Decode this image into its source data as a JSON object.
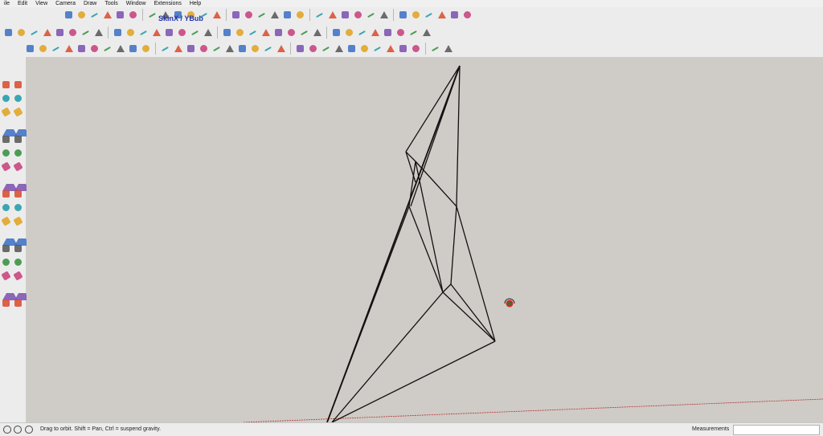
{
  "menu": [
    "ile",
    "Edit",
    "View",
    "Camera",
    "Draw",
    "Tools",
    "Window",
    "Extensions",
    "Help"
  ],
  "toolbar": {
    "skin_label": "SkinX / YBub",
    "row1_icons": [
      "skp-icon",
      "play-icon",
      "stop-icon",
      "rewind-icon",
      "cube-icon",
      "person-icon",
      "orange-cube-icon",
      "tower-icon",
      "red-stop-icon",
      "skin-icon",
      "curve-icon",
      "bend-icon",
      "vertex-icon",
      "flat-icon",
      "wave-icon",
      "path-icon",
      "cross-icon",
      "diamond-icon",
      "grid-icon",
      "layers-icon",
      "stack-icon",
      "camera-icon",
      "folder-icon",
      "book-icon",
      "tile-icon",
      "gem-icon",
      "house-icon",
      "roof-icon",
      "cup-icon",
      "box-icon"
    ],
    "row2_icons": [
      "select-icon",
      "eraser-icon",
      "pencil-icon",
      "arc-icon",
      "rectangle-icon",
      "pushpull-icon",
      "move-icon",
      "rotate-icon",
      "scale-icon",
      "tape-icon",
      "text-icon",
      "orbit-icon",
      "pan-icon",
      "zoom-icon",
      "extents-icon",
      "paint-icon",
      "component-icon",
      "solid-icon",
      "shadow-icon",
      "lock-icon",
      "section-icon",
      "clock-icon",
      "teapot-icon",
      "layer-icon",
      "window-icon",
      "frame-icon",
      "cube-outline-icon",
      "sandbox-icon",
      "protractor-icon",
      "circle-icon",
      "axes-icon",
      "sun-icon"
    ],
    "row3_icons": [
      "shape-icon",
      "draw-icon",
      "bezier-icon",
      "spline-icon",
      "offset-icon",
      "fillet-icon",
      "chamfer-icon",
      "extrude-icon",
      "loft-icon",
      "sweep-icon",
      "twist-icon",
      "shell-icon",
      "cut-icon",
      "hole-icon",
      "weld-icon",
      "split-icon",
      "edge-icon",
      "join-icon",
      "trim-icon",
      "extend-icon",
      "mirror-icon",
      "array-icon",
      "pattern-icon",
      "hatch-icon",
      "mesh-icon",
      "smooth-icon",
      "soften-icon",
      "subdivide-icon",
      "relax-icon",
      "flatten-icon",
      "stamp-icon",
      "drape-icon"
    ]
  },
  "left_toolbar_icons": [
    "select-icon",
    "component-icon",
    "paint-icon",
    "eraser-icon",
    "line-icon",
    "freehand-icon",
    "rectangle-icon",
    "rotated-rect-icon",
    "circle-icon",
    "polygon-icon",
    "arc-icon",
    "pie-icon",
    "move-icon",
    "pushpull-icon",
    "rotate-icon",
    "followme-icon",
    "scale-icon",
    "offset-icon",
    "tape-icon",
    "dimension-icon",
    "protractor-icon",
    "text-icon",
    "axes-icon",
    "3dtext-icon",
    "orbit-icon",
    "pan-icon",
    "zoom-icon",
    "zoomwindow-icon",
    "extents-icon",
    "previous-icon",
    "position-camera-icon",
    "lookaround-icon",
    "walk-icon",
    "section-icon"
  ],
  "colors": {
    "canvas": "#cfcbc6",
    "toolbar": "#ececec",
    "edge": "#111111",
    "red_axis": "#b33030"
  },
  "status": {
    "message": "Drag to orbit. Shift = Pan, Ctrl = suspend gravity.",
    "measurements_label": "Measurements",
    "measurements_value": ""
  }
}
